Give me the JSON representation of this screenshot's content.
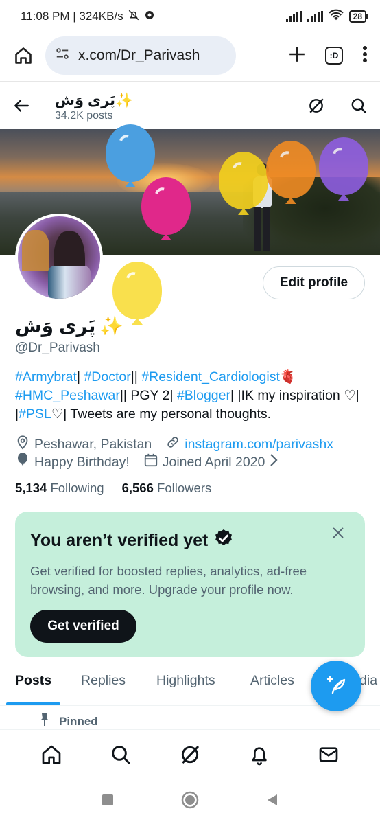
{
  "status_bar": {
    "time_speed": "11:08 PM | 324KB/s",
    "battery": "28"
  },
  "browser": {
    "url": "x.com/Dr_Parivash",
    "tabs_label": ":D"
  },
  "profile_header": {
    "name": "پَری وَش✨",
    "posts": "34.2K posts"
  },
  "profile": {
    "display_name": "پَری وَش",
    "sparkle": "✨",
    "handle": "@Dr_Parivash",
    "edit_label": "Edit profile",
    "bio": {
      "tag1": "#Armybrat",
      "sep1": "| ",
      "tag2": "#Doctor",
      "sep2": "|| ",
      "tag3": "#Resident_Cardiologist",
      "heart": "🫀",
      "tag4": "#HMC_Peshawar",
      "sep3": "|| PGY 2| ",
      "tag5": "#Blogger",
      "sep4": "| |IK my inspiration ♡| |",
      "tag6": "#PSL",
      "sep5": "♡| Tweets are my personal thoughts."
    },
    "location": "Peshawar, Pakistan",
    "website": "instagram.com/parivashx",
    "birthday": "Happy Birthday!",
    "joined": "Joined April 2020",
    "following_count": "5,134",
    "following_label": "Following",
    "followers_count": "6,566",
    "followers_label": "Followers"
  },
  "verify_card": {
    "title": "You aren’t verified yet",
    "description": "Get verified for boosted replies, analytics, ad-free browsing, and more. Upgrade your profile now.",
    "button": "Get verified"
  },
  "tabs": [
    "Posts",
    "Replies",
    "Highlights",
    "Articles",
    "Media"
  ],
  "pinned_label": "Pinned",
  "colors": {
    "accent": "#1d9bf0",
    "card_bg": "#c5efdb",
    "text": "#0f1419",
    "muted": "#536471"
  }
}
